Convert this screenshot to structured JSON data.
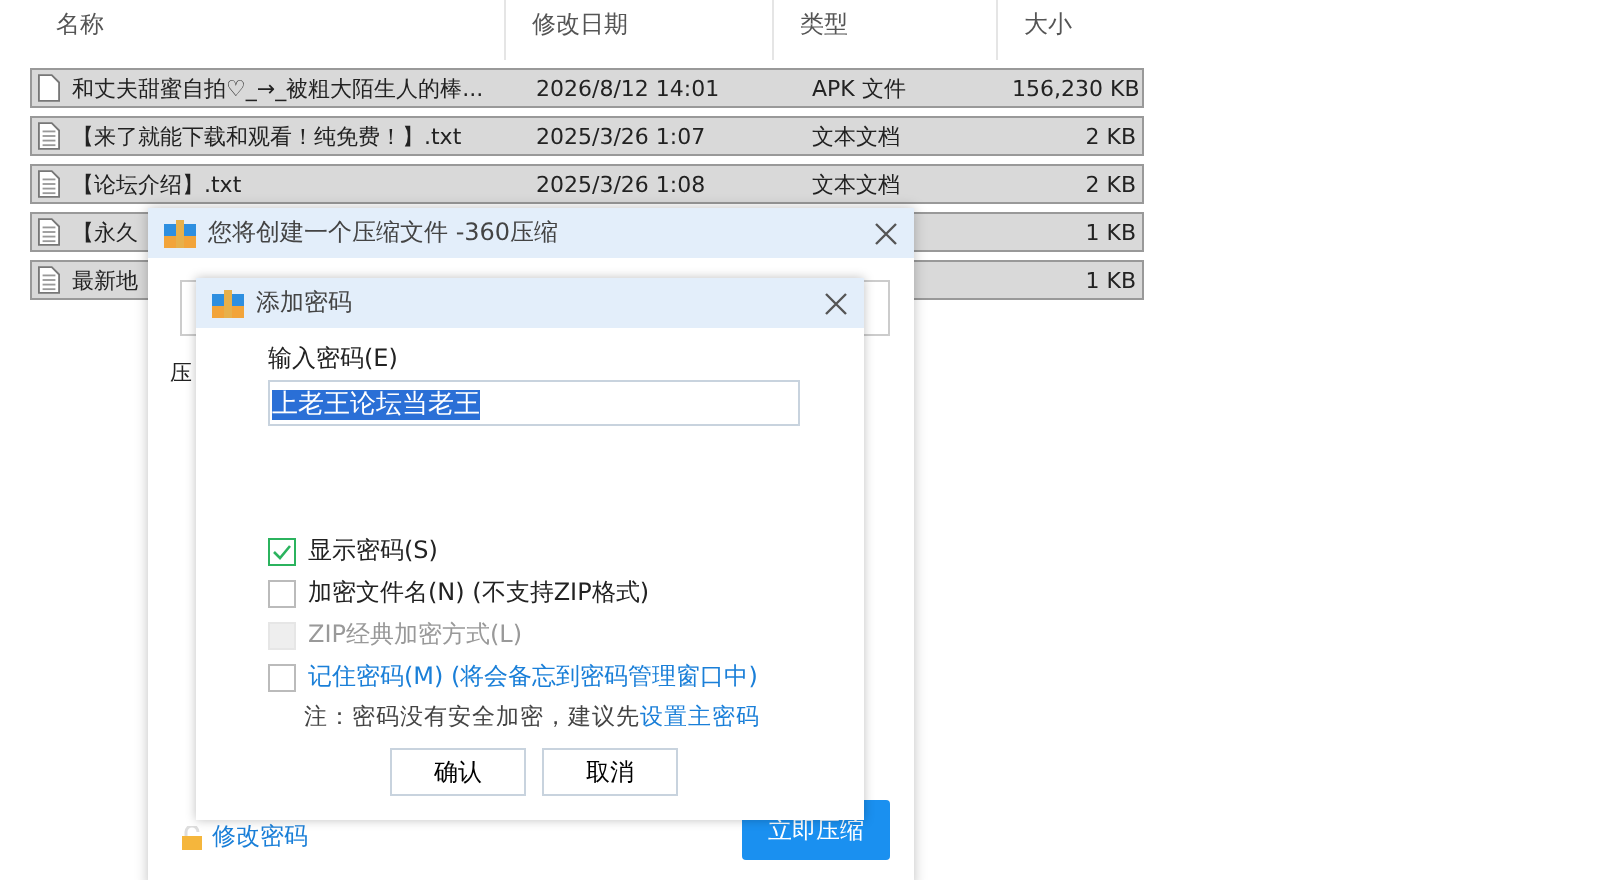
{
  "explorer": {
    "columns": [
      "名称",
      "修改日期",
      "类型",
      "大小"
    ],
    "rows": [
      {
        "name": "和丈夫甜蜜自拍♡_→_被粗大陌生人的棒...",
        "date": "2026/8/12 14:01",
        "type": "APK 文件",
        "size": "156,230 KB",
        "kind": "blank",
        "selected": true
      },
      {
        "name": "【来了就能下载和观看！纯免费！】.txt",
        "date": "2025/3/26 1:07",
        "type": "文本文档",
        "size": "2 KB",
        "kind": "text",
        "selected": true
      },
      {
        "name": "【论坛介绍】.txt",
        "date": "2025/3/26 1:08",
        "type": "文本文档",
        "size": "2 KB",
        "kind": "text",
        "selected": true
      },
      {
        "name": "【永久",
        "size": "1 KB",
        "kind": "text",
        "selected": true
      },
      {
        "name": "最新地",
        "size": "1 KB",
        "kind": "text",
        "selected": true
      }
    ]
  },
  "compress_dialog": {
    "title": "您将创建一个压缩文件 -360压缩",
    "label_fragment": "压",
    "change_password_link": "修改密码",
    "compress_button": "立即压缩"
  },
  "password_dialog": {
    "title": "添加密码",
    "password_label": "输入密码(E)",
    "password_value": "上老王论坛当老王",
    "options": [
      {
        "label": "显示密码(S)",
        "checked": true,
        "disabled": false,
        "kind": "plain"
      },
      {
        "label": "加密文件名(N) (不支持ZIP格式)",
        "checked": false,
        "disabled": false,
        "kind": "plain"
      },
      {
        "label": "ZIP经典加密方式(L)",
        "checked": false,
        "disabled": true,
        "kind": "plain"
      },
      {
        "label": "记住密码(M) (将会备忘到密码管理窗口中)",
        "checked": false,
        "disabled": false,
        "kind": "link"
      }
    ],
    "note": "注：密码没有安全加密，建议先",
    "note_link": "设置主密码",
    "buttons": [
      "确认",
      "取消"
    ]
  }
}
